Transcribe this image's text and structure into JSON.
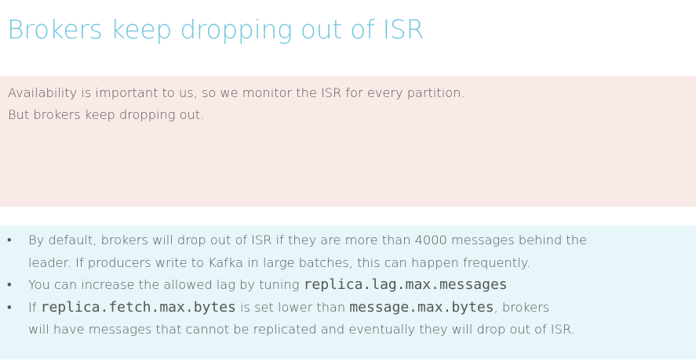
{
  "title": "Brokers keep dropping out of ISR",
  "problem": {
    "lines": [
      "Availability is important to us, so we monitor the ISR for every partition.",
      "But brokers keep dropping out."
    ]
  },
  "solution": {
    "bullet_marker": "•",
    "bullets": [
      {
        "lines": [
          "By default, brokers will drop out of ISR if they are more than 4000 messages behind the",
          "leader. If producers write to Kafka in large batches, this can happen frequently."
        ]
      },
      {
        "text": "You can increase the allowed lag by tuning ",
        "code": "replica.lag.max.messages"
      },
      {
        "pre": "If ",
        "code1": "replica.fetch.max.bytes",
        "mid": " is set lower than ",
        "code2": "message.max.bytes",
        "post": ", brokers",
        "line2": "will have messages that cannot be replicated and eventually they will drop out of ISR."
      }
    ]
  }
}
